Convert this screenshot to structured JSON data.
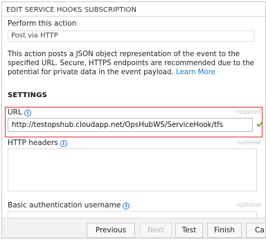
{
  "dialog": {
    "title": "EDIT SERVICE HOOKS SUBSCRIPTION"
  },
  "action": {
    "label": "Perform this action",
    "value": "Post via HTTP",
    "description": "This action posts a JSON object representation of the event to the specified URL. Secure, HTTPS endpoints are recommended due to the potential for private data in the event payload.",
    "learn_more": "Learn More"
  },
  "settings": {
    "heading": "SETTINGS",
    "url": {
      "label": "URL",
      "hint": "required",
      "value": "http://testopshub.cloudapp.net/OpsHubWS/ServiceHook/tfs",
      "valid_icon": "checkmark-icon"
    },
    "http_headers": {
      "label": "HTTP headers",
      "hint": "optional",
      "value": ""
    },
    "basic_auth_username": {
      "label": "Basic authentication username",
      "hint": "optional",
      "value": ""
    }
  },
  "buttons": {
    "previous": "Previous",
    "next": "Next",
    "test": "Test",
    "finish": "Finish",
    "cancel": "Ca"
  },
  "colors": {
    "link": "#1a73d1",
    "highlight_border": "#e0242c",
    "valid_check": "#5aa02c"
  }
}
